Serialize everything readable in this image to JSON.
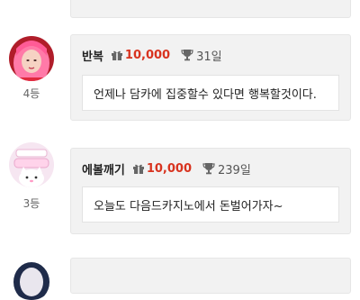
{
  "entries": [
    {
      "rank": "4등",
      "nickname": "반복",
      "points": "10,000",
      "days": "31일",
      "comment": "언제나 담카에 집중할수 있다면 행복할것이다."
    },
    {
      "rank": "3등",
      "nickname": "에볼깨기",
      "points": "10,000",
      "days": "239일",
      "comment": "오늘도 다음드카지노에서 돈벌어가자~"
    }
  ],
  "colors": {
    "points": "#d8331f",
    "card_bg": "#f2f2f2",
    "inner_bg": "#ffffff"
  },
  "icons": {
    "points_icon": "gift-icon",
    "days_icon": "trophy-icon"
  }
}
